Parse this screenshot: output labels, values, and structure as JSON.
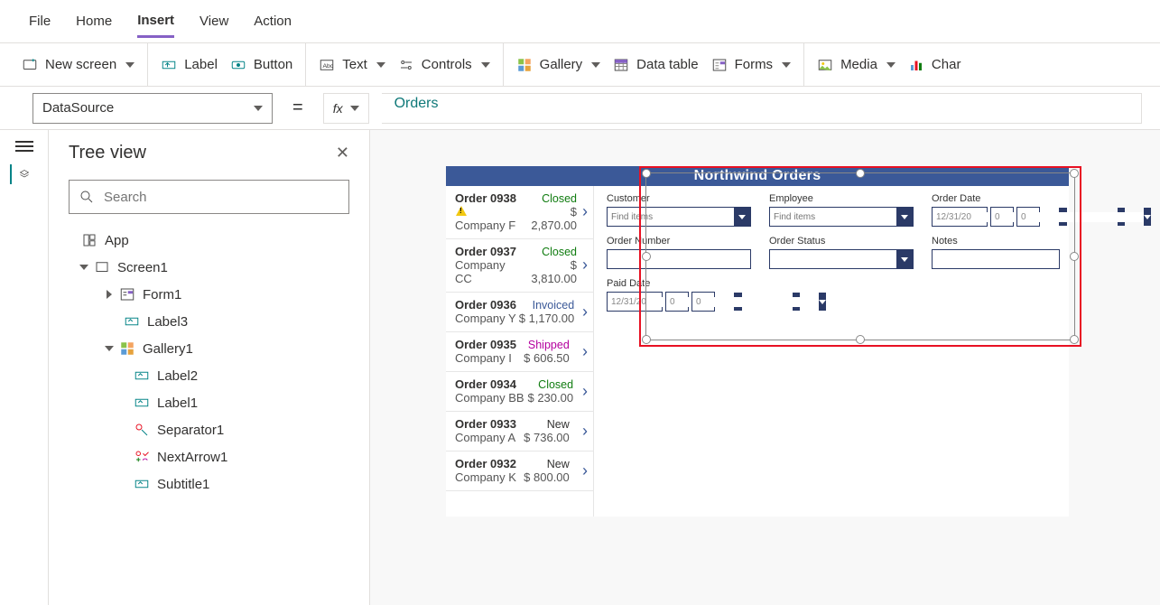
{
  "menu": {
    "items": [
      "File",
      "Home",
      "Insert",
      "View",
      "Action"
    ],
    "active": "Insert"
  },
  "ribbon": {
    "new_screen": "New screen",
    "label": "Label",
    "button": "Button",
    "text": "Text",
    "controls": "Controls",
    "gallery": "Gallery",
    "data_table": "Data table",
    "forms": "Forms",
    "media": "Media",
    "charts": "Char"
  },
  "formula": {
    "property": "DataSource",
    "fx": "fx",
    "value": "Orders"
  },
  "tree": {
    "title": "Tree view",
    "search_placeholder": "Search",
    "app": "App",
    "screen": "Screen1",
    "form": "Form1",
    "label3": "Label3",
    "gallery": "Gallery1",
    "label2": "Label2",
    "label1": "Label1",
    "separator": "Separator1",
    "nextarrow": "NextArrow1",
    "subtitle": "Subtitle1"
  },
  "app": {
    "title": "Northwind Orders"
  },
  "orders": [
    {
      "id": "Order 0938",
      "warn": true,
      "company": "Company F",
      "status": "Closed",
      "amount": "$ 2,870.00"
    },
    {
      "id": "Order 0937",
      "company": "Company CC",
      "status": "Closed",
      "amount": "$ 3,810.00"
    },
    {
      "id": "Order 0936",
      "company": "Company Y",
      "status": "Invoiced",
      "amount": "$ 1,170.00"
    },
    {
      "id": "Order 0935",
      "company": "Company I",
      "status": "Shipped",
      "amount": "$ 606.50"
    },
    {
      "id": "Order 0934",
      "company": "Company BB",
      "status": "Closed",
      "amount": "$ 230.00"
    },
    {
      "id": "Order 0933",
      "company": "Company A",
      "status": "New",
      "amount": "$ 736.00"
    },
    {
      "id": "Order 0932",
      "company": "Company K",
      "status": "New",
      "amount": "$ 800.00"
    }
  ],
  "form": {
    "customer": {
      "label": "Customer",
      "placeholder": "Find items"
    },
    "employee": {
      "label": "Employee",
      "placeholder": "Find items"
    },
    "orderdate": {
      "label": "Order Date",
      "value": "12/31/20",
      "h": "0",
      "m": "0"
    },
    "ordernumber": {
      "label": "Order Number"
    },
    "orderstatus": {
      "label": "Order Status"
    },
    "notes": {
      "label": "Notes"
    },
    "paiddate": {
      "label": "Paid Date",
      "value": "12/31/20",
      "h": "0",
      "m": "0"
    }
  }
}
